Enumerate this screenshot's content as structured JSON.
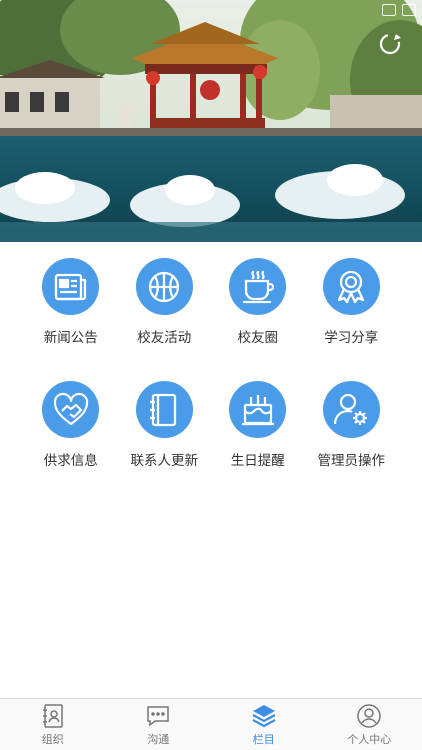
{
  "hero": {
    "photo": "park-pavilion-spring"
  },
  "grid": {
    "items": [
      {
        "label": "新闻公告",
        "icon": "newspaper-icon"
      },
      {
        "label": "校友活动",
        "icon": "basketball-icon"
      },
      {
        "label": "校友圈",
        "icon": "cup-icon"
      },
      {
        "label": "学习分享",
        "icon": "award-icon"
      },
      {
        "label": "供求信息",
        "icon": "heart-handshake-icon"
      },
      {
        "label": "联系人更新",
        "icon": "notebook-icon"
      },
      {
        "label": "生日提醒",
        "icon": "birthday-cake-icon"
      },
      {
        "label": "管理员操作",
        "icon": "admin-settings-icon"
      }
    ]
  },
  "tabbar": {
    "tabs": [
      {
        "label": "组织",
        "icon": "contacts-book-icon",
        "active": false
      },
      {
        "label": "沟通",
        "icon": "chat-icon",
        "active": false
      },
      {
        "label": "栏目",
        "icon": "layers-icon",
        "active": true
      },
      {
        "label": "个人中心",
        "icon": "user-icon",
        "active": false
      }
    ],
    "accent": "#3b8ee0"
  },
  "colors": {
    "icon_circle": "#4a9be8"
  }
}
